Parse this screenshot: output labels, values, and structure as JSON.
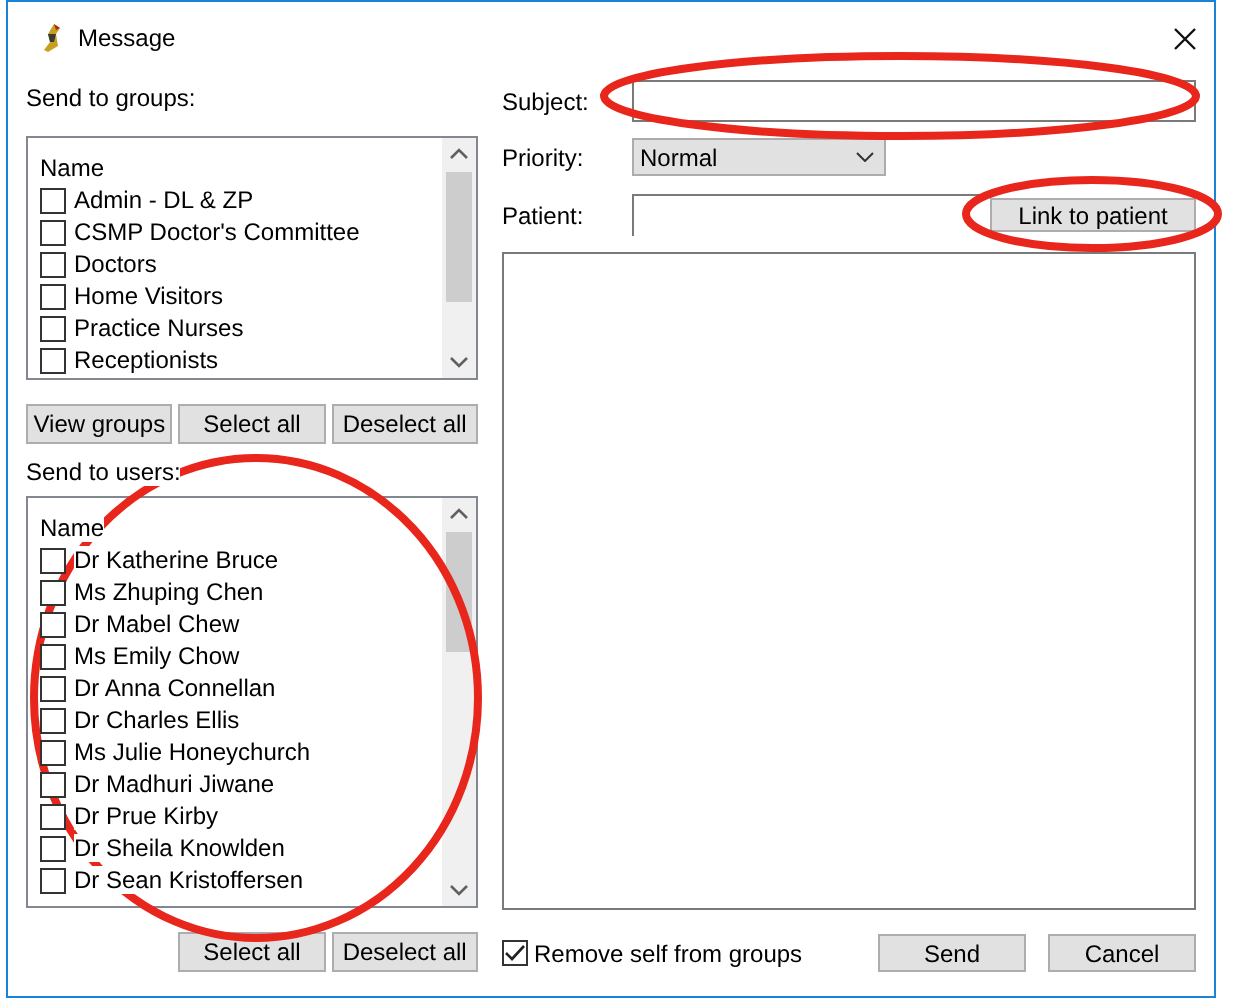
{
  "window": {
    "title": "Message"
  },
  "groups": {
    "label": "Send to groups:",
    "column": "Name",
    "items": [
      {
        "name": "Admin - DL & ZP",
        "checked": false
      },
      {
        "name": "CSMP Doctor's Committee",
        "checked": false
      },
      {
        "name": "Doctors",
        "checked": false
      },
      {
        "name": "Home Visitors",
        "checked": false
      },
      {
        "name": "Practice Nurses",
        "checked": false
      },
      {
        "name": "Receptionists",
        "checked": false
      }
    ],
    "buttons": [
      "View groups",
      "Select all",
      "Deselect all"
    ]
  },
  "users": {
    "label": "Send to users:",
    "column": "Name",
    "items": [
      {
        "name": "Dr Katherine Bruce",
        "checked": false
      },
      {
        "name": "Ms Zhuping Chen",
        "checked": false
      },
      {
        "name": "Dr Mabel Chew",
        "checked": false
      },
      {
        "name": "Ms Emily Chow",
        "checked": false
      },
      {
        "name": "Dr Anna Connellan",
        "checked": false
      },
      {
        "name": "Dr Charles Ellis",
        "checked": false
      },
      {
        "name": "Ms Julie Honeychurch",
        "checked": false
      },
      {
        "name": "Dr Madhuri Jiwane",
        "checked": false
      },
      {
        "name": "Dr Prue Kirby",
        "checked": false
      },
      {
        "name": "Dr Sheila Knowlden",
        "checked": false
      },
      {
        "name": "Dr Sean Kristoffersen",
        "checked": false
      }
    ],
    "buttons": [
      "Select all",
      "Deselect all"
    ]
  },
  "subject": {
    "label": "Subject:"
  },
  "priority": {
    "label": "Priority:",
    "value": "Normal"
  },
  "patient": {
    "label": "Patient:",
    "button": "Link to patient"
  },
  "remove_self": {
    "label": "Remove self from groups",
    "checked": true
  },
  "actions": [
    "Send",
    "Cancel"
  ]
}
